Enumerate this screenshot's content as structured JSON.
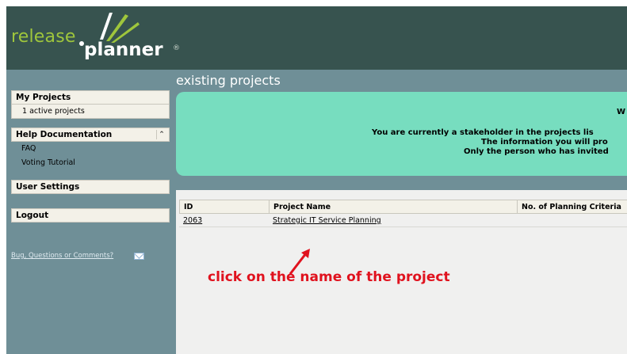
{
  "header": {
    "logo_part1": "release",
    "logo_part2": "planner",
    "logo_reg": "®"
  },
  "section_title": "existing projects",
  "sidebar": {
    "my_projects": {
      "title": "My Projects",
      "items": [
        "1 active projects"
      ]
    },
    "help": {
      "title": "Help Documentation",
      "collapse_icon": "double-chevron-up-icon",
      "items": [
        "FAQ",
        "Voting Tutorial"
      ]
    },
    "user_settings": "User Settings",
    "logout": "Logout",
    "bug_link": "Bug, Questions or Comments?",
    "mail_icon": "mail-icon"
  },
  "welcome": {
    "line1": "W",
    "line2": "You are currently a stakeholder in the projects lis",
    "line3": "The information you will pro",
    "line4": "Only the person who has invited"
  },
  "table": {
    "columns": [
      "ID",
      "Project Name",
      "No. of Planning Criteria"
    ],
    "rows": [
      {
        "id": "2063",
        "name": "Strategic IT Service Planning"
      }
    ]
  },
  "annotation": {
    "text": "click on the name of the project",
    "color": "#e0121e"
  },
  "colors": {
    "header_bg": "#37534f",
    "page_bg": "#6f8f97",
    "welcome_bg": "#77ddbf",
    "logo_green": "#9fc63c"
  }
}
